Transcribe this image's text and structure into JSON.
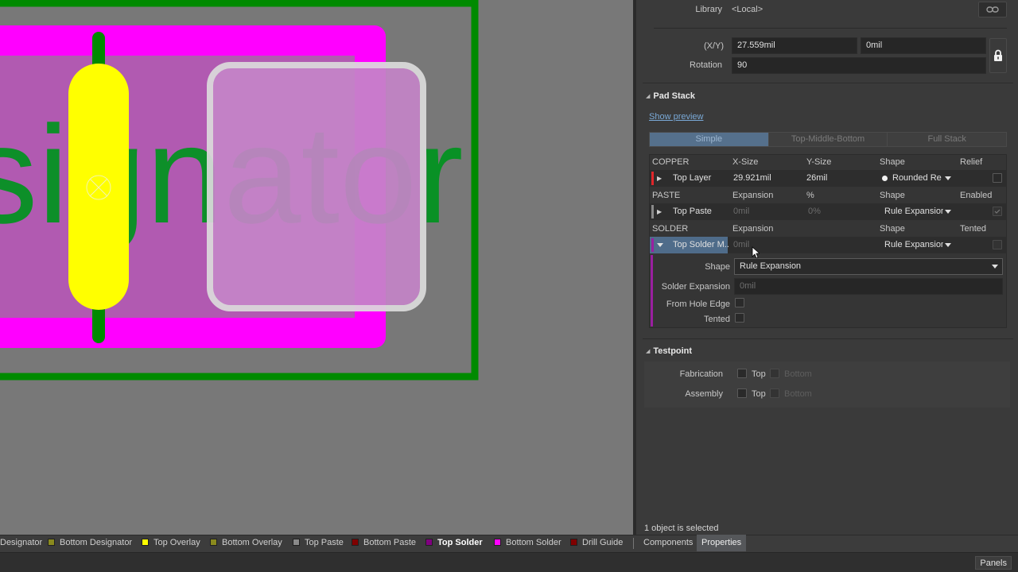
{
  "canvas": {
    "designator_text": "signator",
    "colors": {
      "background": "#787878",
      "outline": "#008a00",
      "solder_mask": "#ff00ff",
      "paste_pad": "#c58ac8",
      "overlay": "#ffff00",
      "designator": "#00941e"
    }
  },
  "panel": {
    "library_label": "Library",
    "library_value": "<Local>",
    "xy_label": "(X/Y)",
    "x_value": "27.559mil",
    "y_value": "0mil",
    "rotation_label": "Rotation",
    "rotation_value": "90",
    "pad_stack": {
      "title": "Pad Stack",
      "show_preview": "Show preview",
      "modes": [
        "Simple",
        "Top-Middle-Bottom",
        "Full Stack"
      ],
      "active_mode": "Simple",
      "copper": {
        "header": [
          "COPPER",
          "X-Size",
          "Y-Size",
          "Shape",
          "Relief"
        ],
        "layer": "Top Layer",
        "x_size": "29.921mil",
        "y_size": "26mil",
        "shape": "Rounded Rec",
        "color": "#e0262a"
      },
      "paste": {
        "header": [
          "PASTE",
          "Expansion",
          "%",
          "Shape",
          "Enabled"
        ],
        "layer": "Top Paste",
        "expansion": "0mil",
        "percent": "0%",
        "shape": "Rule Expansion",
        "color": "#8a8a8a"
      },
      "solder": {
        "header": [
          "SOLDER",
          "Expansion",
          "",
          "Shape",
          "Tented"
        ],
        "layer": "Top Solder M...",
        "expansion": "0mil",
        "shape": "Rule Expansion",
        "color": "#9a1fa0",
        "detail": {
          "shape_label": "Shape",
          "shape_value": "Rule Expansion",
          "solder_expansion_label": "Solder Expansion",
          "solder_expansion_value": "0mil",
          "from_hole_edge_label": "From Hole Edge",
          "tented_label": "Tented"
        }
      }
    },
    "testpoint": {
      "title": "Testpoint",
      "fabrication_label": "Fabrication",
      "assembly_label": "Assembly",
      "top_label": "Top",
      "bottom_label": "Bottom"
    },
    "status": "1 object is selected",
    "tabs": [
      "Components",
      "Properties"
    ],
    "active_tab": "Properties"
  },
  "layer_tabs": [
    {
      "label": "Designator",
      "color": "",
      "active": false
    },
    {
      "label": "Bottom Designator",
      "color": "#8a8a1e",
      "active": false
    },
    {
      "label": "Top Overlay",
      "color": "#ffff00",
      "active": false
    },
    {
      "label": "Bottom Overlay",
      "color": "#8a8a1e",
      "active": false
    },
    {
      "label": "Top Paste",
      "color": "#8a8a8a",
      "active": false
    },
    {
      "label": "Bottom Paste",
      "color": "#800000",
      "active": false
    },
    {
      "label": "Top Solder",
      "color": "#800080",
      "active": true
    },
    {
      "label": "Bottom Solder",
      "color": "#ff00ff",
      "active": false
    },
    {
      "label": "Drill Guide",
      "color": "#800000",
      "active": false
    }
  ],
  "bottom": {
    "panels_button": "Panels"
  }
}
